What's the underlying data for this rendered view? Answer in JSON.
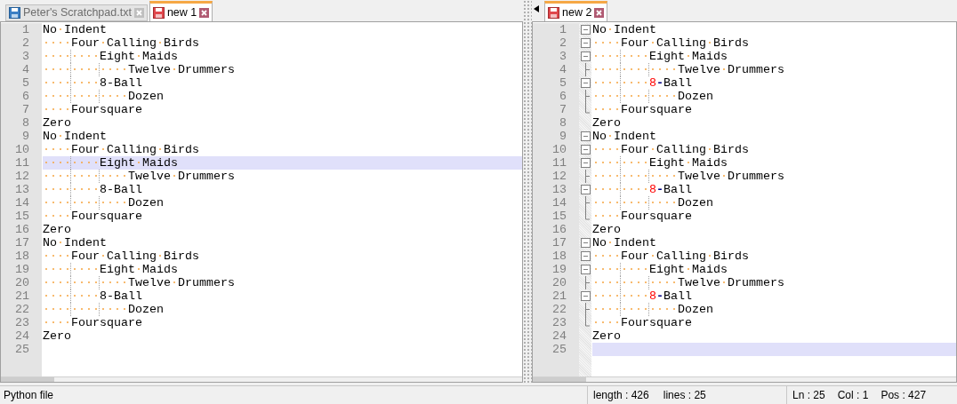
{
  "panes": [
    {
      "tabs": [
        {
          "label": "Peter's Scratchpad.txt",
          "selected": false,
          "saved": true
        },
        {
          "label": "new 1",
          "selected": true,
          "saved": false
        }
      ],
      "scroll_arrow": false,
      "lines": [
        {
          "number": "1",
          "tokens": [
            {
              "kind": "plain",
              "text": "No·Indent"
            }
          ],
          "current": false
        },
        {
          "number": "2",
          "indent": "····",
          "tokens": [
            {
              "kind": "plain",
              "text": "Four·Calling·Birds"
            }
          ],
          "current": false
        },
        {
          "number": "3",
          "indent": "········",
          "tokens": [
            {
              "kind": "plain",
              "text": "Eight·Maids"
            }
          ],
          "current": false
        },
        {
          "number": "4",
          "indent": "············",
          "tokens": [
            {
              "kind": "plain",
              "text": "Twelve·Drummers"
            }
          ],
          "current": false
        },
        {
          "number": "5",
          "indent": "········",
          "tokens": [
            {
              "kind": "plain",
              "text": "8-Ball"
            }
          ],
          "current": false
        },
        {
          "number": "6",
          "indent": "············",
          "tokens": [
            {
              "kind": "plain",
              "text": "Dozen"
            }
          ],
          "current": false
        },
        {
          "number": "7",
          "indent": "····",
          "tokens": [
            {
              "kind": "plain",
              "text": "Foursquare"
            }
          ],
          "current": false
        },
        {
          "number": "8",
          "tokens": [
            {
              "kind": "plain",
              "text": "Zero"
            }
          ],
          "current": false
        },
        {
          "number": "9",
          "tokens": [
            {
              "kind": "plain",
              "text": "No·Indent"
            }
          ],
          "current": false
        },
        {
          "number": "10",
          "indent": "····",
          "tokens": [
            {
              "kind": "plain",
              "text": "Four·Calling·Birds"
            }
          ],
          "current": false
        },
        {
          "number": "11",
          "indent": "········",
          "tokens": [
            {
              "kind": "plain",
              "text": "Eight·Maids"
            }
          ],
          "current": true
        },
        {
          "number": "12",
          "indent": "············",
          "tokens": [
            {
              "kind": "plain",
              "text": "Twelve·Drummers"
            }
          ],
          "current": false
        },
        {
          "number": "13",
          "indent": "········",
          "tokens": [
            {
              "kind": "plain",
              "text": "8-Ball"
            }
          ],
          "current": false
        },
        {
          "number": "14",
          "indent": "············",
          "tokens": [
            {
              "kind": "plain",
              "text": "Dozen"
            }
          ],
          "current": false
        },
        {
          "number": "15",
          "indent": "····",
          "tokens": [
            {
              "kind": "plain",
              "text": "Foursquare"
            }
          ],
          "current": false
        },
        {
          "number": "16",
          "tokens": [
            {
              "kind": "plain",
              "text": "Zero"
            }
          ],
          "current": false
        },
        {
          "number": "17",
          "tokens": [
            {
              "kind": "plain",
              "text": "No·Indent"
            }
          ],
          "current": false
        },
        {
          "number": "18",
          "indent": "····",
          "tokens": [
            {
              "kind": "plain",
              "text": "Four·Calling·Birds"
            }
          ],
          "current": false
        },
        {
          "number": "19",
          "indent": "········",
          "tokens": [
            {
              "kind": "plain",
              "text": "Eight·Maids"
            }
          ],
          "current": false
        },
        {
          "number": "20",
          "indent": "············",
          "tokens": [
            {
              "kind": "plain",
              "text": "Twelve·Drummers"
            }
          ],
          "current": false
        },
        {
          "number": "21",
          "indent": "········",
          "tokens": [
            {
              "kind": "plain",
              "text": "8-Ball"
            }
          ],
          "current": false
        },
        {
          "number": "22",
          "indent": "············",
          "tokens": [
            {
              "kind": "plain",
              "text": "Dozen"
            }
          ],
          "current": false
        },
        {
          "number": "23",
          "indent": "····",
          "tokens": [
            {
              "kind": "plain",
              "text": "Foursquare"
            }
          ],
          "current": false
        },
        {
          "number": "24",
          "tokens": [
            {
              "kind": "plain",
              "text": "Zero"
            }
          ],
          "current": false
        },
        {
          "number": "25",
          "current": false
        }
      ]
    },
    {
      "tabs": [
        {
          "label": "new 2",
          "selected": true,
          "saved": false
        }
      ],
      "scroll_arrow": true,
      "lines": [
        {
          "number": "1",
          "kind": "fold-open",
          "tokens": [
            {
              "kind": "plain",
              "text": "No·Indent"
            }
          ],
          "current": false
        },
        {
          "number": "2",
          "kind": "fold-open",
          "indent": "····",
          "tokens": [
            {
              "kind": "plain",
              "text": "Four·Calling·Birds"
            }
          ],
          "current": false
        },
        {
          "number": "3",
          "kind": "fold-open",
          "indent": "········",
          "tokens": [
            {
              "kind": "plain",
              "text": "Eight·Maids"
            }
          ],
          "current": false
        },
        {
          "number": "4",
          "kind": "fold-branch",
          "indent": "············",
          "tokens": [
            {
              "kind": "plain",
              "text": "Twelve·Drummers"
            }
          ],
          "current": false
        },
        {
          "number": "5",
          "kind": "fold-open",
          "indent": "········",
          "tokens": [
            {
              "kind": "number",
              "text": "8"
            },
            {
              "kind": "operator",
              "text": "-"
            },
            {
              "kind": "plain",
              "text": "Ball"
            }
          ],
          "current": false
        },
        {
          "number": "6",
          "kind": "fold-branch",
          "indent": "············",
          "tokens": [
            {
              "kind": "plain",
              "text": "Dozen"
            }
          ],
          "current": false
        },
        {
          "number": "7",
          "kind": "fold-end",
          "indent": "····",
          "tokens": [
            {
              "kind": "plain",
              "text": "Foursquare"
            }
          ],
          "current": false
        },
        {
          "number": "8",
          "kind": "plain",
          "tokens": [
            {
              "kind": "plain",
              "text": "Zero"
            }
          ],
          "current": false
        },
        {
          "number": "9",
          "kind": "fold-open",
          "tokens": [
            {
              "kind": "plain",
              "text": "No·Indent"
            }
          ],
          "current": false
        },
        {
          "number": "10",
          "kind": "fold-open",
          "indent": "····",
          "tokens": [
            {
              "kind": "plain",
              "text": "Four·Calling·Birds"
            }
          ],
          "current": false
        },
        {
          "number": "11",
          "kind": "fold-open",
          "indent": "········",
          "tokens": [
            {
              "kind": "plain",
              "text": "Eight·Maids"
            }
          ],
          "current": false
        },
        {
          "number": "12",
          "kind": "fold-branch",
          "indent": "············",
          "tokens": [
            {
              "kind": "plain",
              "text": "Twelve·Drummers"
            }
          ],
          "current": false
        },
        {
          "number": "13",
          "kind": "fold-open",
          "indent": "········",
          "tokens": [
            {
              "kind": "number",
              "text": "8"
            },
            {
              "kind": "operator",
              "text": "-"
            },
            {
              "kind": "plain",
              "text": "Ball"
            }
          ],
          "current": false
        },
        {
          "number": "14",
          "kind": "fold-branch",
          "indent": "············",
          "tokens": [
            {
              "kind": "plain",
              "text": "Dozen"
            }
          ],
          "current": false
        },
        {
          "number": "15",
          "kind": "fold-end",
          "indent": "····",
          "tokens": [
            {
              "kind": "plain",
              "text": "Foursquare"
            }
          ],
          "current": false
        },
        {
          "number": "16",
          "kind": "plain",
          "tokens": [
            {
              "kind": "plain",
              "text": "Zero"
            }
          ],
          "current": false
        },
        {
          "number": "17",
          "kind": "fold-open",
          "tokens": [
            {
              "kind": "plain",
              "text": "No·Indent"
            }
          ],
          "current": false
        },
        {
          "number": "18",
          "kind": "fold-open",
          "indent": "····",
          "tokens": [
            {
              "kind": "plain",
              "text": "Four·Calling·Birds"
            }
          ],
          "current": false
        },
        {
          "number": "19",
          "kind": "fold-open",
          "indent": "········",
          "tokens": [
            {
              "kind": "plain",
              "text": "Eight·Maids"
            }
          ],
          "current": false
        },
        {
          "number": "20",
          "kind": "fold-branch",
          "indent": "············",
          "tokens": [
            {
              "kind": "plain",
              "text": "Twelve·Drummers"
            }
          ],
          "current": false
        },
        {
          "number": "21",
          "kind": "fold-open",
          "indent": "········",
          "tokens": [
            {
              "kind": "number",
              "text": "8"
            },
            {
              "kind": "operator",
              "text": "-"
            },
            {
              "kind": "plain",
              "text": "Ball"
            }
          ],
          "current": false
        },
        {
          "number": "22",
          "kind": "fold-branch",
          "indent": "············",
          "tokens": [
            {
              "kind": "plain",
              "text": "Dozen"
            }
          ],
          "current": false
        },
        {
          "number": "23",
          "kind": "fold-end",
          "indent": "····",
          "tokens": [
            {
              "kind": "plain",
              "text": "Foursquare"
            }
          ],
          "current": false
        },
        {
          "number": "24",
          "kind": "plain",
          "tokens": [
            {
              "kind": "plain",
              "text": "Zero"
            }
          ],
          "current": false
        },
        {
          "number": "25",
          "kind": "plain",
          "current": true
        }
      ]
    }
  ],
  "status_bar": {
    "language": "Python file",
    "length": "length : 426",
    "lines": "lines : 25",
    "line": "Ln : 25",
    "column": "Col : 1",
    "position": "Pos : 427"
  }
}
